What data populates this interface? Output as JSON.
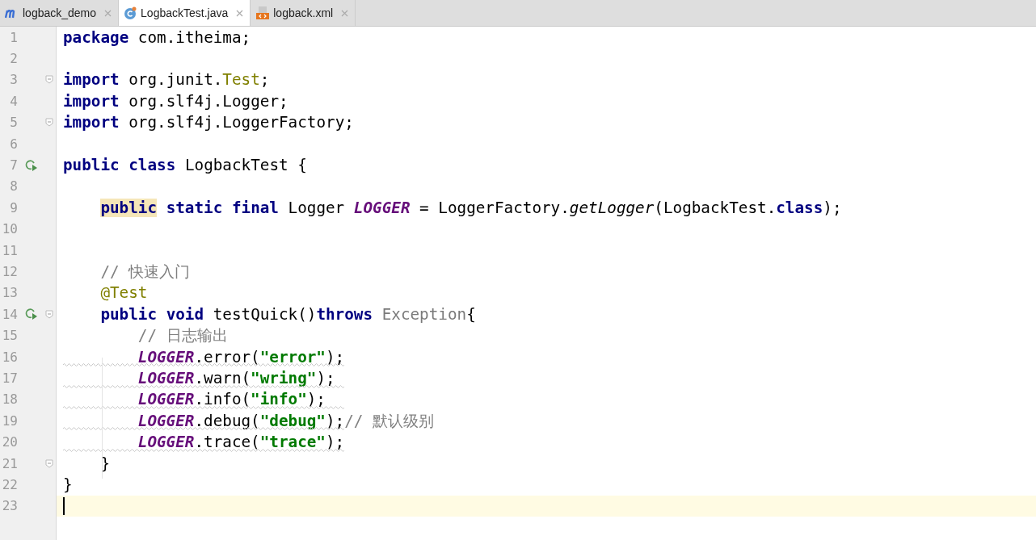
{
  "tabs": [
    {
      "label": "logback_demo",
      "kind": "module",
      "selected": false
    },
    {
      "label": "LogbackTest.java",
      "kind": "class",
      "selected": true
    },
    {
      "label": "logback.xml",
      "kind": "xml",
      "selected": false
    }
  ],
  "editor": {
    "lines": [
      {
        "number": "1",
        "run": false,
        "fold": false,
        "current": false,
        "warning": false,
        "tokens": [
          {
            "kind": "keyword",
            "text": "package"
          },
          {
            "kind": "plain",
            "text": " com.itheima;"
          }
        ]
      },
      {
        "number": "2",
        "run": false,
        "fold": false,
        "current": false,
        "warning": false
      },
      {
        "number": "3",
        "run": false,
        "fold": true,
        "current": false,
        "warning": false,
        "tokens": [
          {
            "kind": "keyword",
            "text": "import"
          },
          {
            "kind": "plain",
            "text": " org.junit."
          },
          {
            "kind": "annotation",
            "text": "Test"
          },
          {
            "kind": "plain",
            "text": ";"
          }
        ]
      },
      {
        "number": "4",
        "run": false,
        "fold": false,
        "current": false,
        "warning": false,
        "tokens": [
          {
            "kind": "keyword",
            "text": "import"
          },
          {
            "kind": "plain",
            "text": " org.slf4j.Logger;"
          }
        ]
      },
      {
        "number": "5",
        "run": false,
        "fold": true,
        "current": false,
        "warning": false,
        "tokens": [
          {
            "kind": "keyword",
            "text": "import"
          },
          {
            "kind": "plain",
            "text": " org.slf4j.LoggerFactory;"
          }
        ]
      },
      {
        "number": "6",
        "run": false,
        "fold": false,
        "current": false,
        "warning": false
      },
      {
        "number": "7",
        "run": true,
        "fold": false,
        "current": false,
        "warning": false,
        "tokens": [
          {
            "kind": "keyword",
            "text": "public class"
          },
          {
            "kind": "plain",
            "text": " LogbackTest {"
          }
        ]
      },
      {
        "number": "8",
        "run": false,
        "fold": false,
        "current": false,
        "warning": false
      },
      {
        "number": "9",
        "run": false,
        "fold": false,
        "current": false,
        "warning": false,
        "tokens": [
          {
            "kind": "keyword-highlighted",
            "text": "public"
          },
          {
            "kind": "keyword",
            "text": " static final"
          },
          {
            "kind": "plain",
            "text": " Logger "
          },
          {
            "kind": "static",
            "text": "LOGGER"
          },
          {
            "kind": "plain",
            "text": " = LoggerFactory."
          },
          {
            "kind": "method",
            "text": "getLogger"
          },
          {
            "kind": "plain",
            "text": "(LogbackTest."
          },
          {
            "kind": "keyword",
            "text": "class"
          },
          {
            "kind": "plain",
            "text": ");"
          }
        ]
      },
      {
        "number": "10",
        "run": false,
        "fold": false,
        "current": false,
        "warning": false
      },
      {
        "number": "11",
        "run": false,
        "fold": false,
        "current": false,
        "warning": false
      },
      {
        "number": "12",
        "run": false,
        "fold": false,
        "current": false,
        "warning": false,
        "tokens": [
          {
            "kind": "comment",
            "text": "// 快速入门"
          }
        ]
      },
      {
        "number": "13",
        "run": false,
        "fold": false,
        "current": false,
        "warning": false,
        "tokens": [
          {
            "kind": "annotation",
            "text": "@Test"
          }
        ]
      },
      {
        "number": "14",
        "run": true,
        "fold": true,
        "current": false,
        "warning": false,
        "tokens": [
          {
            "kind": "keyword",
            "text": "public void"
          },
          {
            "kind": "plain",
            "text": " testQuick()"
          },
          {
            "kind": "keyword",
            "text": "throws"
          },
          {
            "kind": "unused",
            "text": " Exception"
          },
          {
            "kind": "plain",
            "text": "{"
          }
        ]
      },
      {
        "number": "15",
        "run": false,
        "fold": false,
        "current": false,
        "warning": false,
        "tokens": [
          {
            "kind": "comment",
            "text": "// 日志输出"
          }
        ]
      },
      {
        "number": "16",
        "run": false,
        "fold": false,
        "current": false,
        "warning": true,
        "tokens": [
          {
            "kind": "static",
            "text": "LOGGER"
          },
          {
            "kind": "plain",
            "text": ".error("
          },
          {
            "kind": "string",
            "text": "\"error\""
          },
          {
            "kind": "plain",
            "text": ");"
          }
        ]
      },
      {
        "number": "17",
        "run": false,
        "fold": false,
        "current": false,
        "warning": true,
        "tokens": [
          {
            "kind": "static",
            "text": "LOGGER"
          },
          {
            "kind": "plain",
            "text": ".warn("
          },
          {
            "kind": "string",
            "text": "\"wring\""
          },
          {
            "kind": "plain",
            "text": ");"
          }
        ]
      },
      {
        "number": "18",
        "run": false,
        "fold": false,
        "current": false,
        "warning": true,
        "tokens": [
          {
            "kind": "static",
            "text": "LOGGER"
          },
          {
            "kind": "plain",
            "text": ".info("
          },
          {
            "kind": "string",
            "text": "\"info\""
          },
          {
            "kind": "plain",
            "text": ");"
          }
        ]
      },
      {
        "number": "19",
        "run": false,
        "fold": false,
        "current": false,
        "warning": true,
        "tokens": [
          {
            "kind": "static",
            "text": "LOGGER"
          },
          {
            "kind": "plain",
            "text": ".debug("
          },
          {
            "kind": "string",
            "text": "\"debug\""
          },
          {
            "kind": "plain",
            "text": ");"
          },
          {
            "kind": "comment",
            "text": "// 默认级别"
          }
        ]
      },
      {
        "number": "20",
        "run": false,
        "fold": false,
        "current": false,
        "warning": true,
        "tokens": [
          {
            "kind": "static",
            "text": "LOGGER"
          },
          {
            "kind": "plain",
            "text": ".trace("
          },
          {
            "kind": "string",
            "text": "\"trace\""
          },
          {
            "kind": "plain",
            "text": ");"
          }
        ]
      },
      {
        "number": "21",
        "run": false,
        "fold": true,
        "current": false,
        "warning": false,
        "tokens": [
          {
            "kind": "plain",
            "text": "}"
          }
        ]
      },
      {
        "number": "22",
        "run": false,
        "fold": false,
        "current": false,
        "warning": false,
        "tokens": [
          {
            "kind": "plain",
            "text": "}"
          }
        ]
      },
      {
        "number": "23",
        "run": false,
        "fold": false,
        "current": true,
        "warning": false
      }
    ]
  }
}
